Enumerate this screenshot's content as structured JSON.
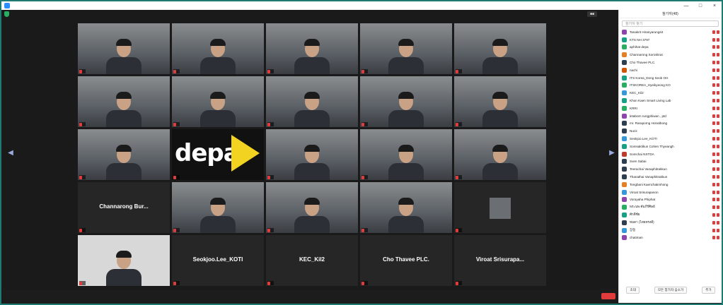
{
  "panel": {
    "title": "참가자(48)",
    "search_placeholder": "참가자 찾기",
    "participants": [
      {
        "name": "Tanakrit Hiranyarungsit",
        "color": "#8e44ad"
      },
      {
        "name": "KTS NH 3797",
        "color": "#16a085"
      },
      {
        "name": "aphihat depa",
        "color": "#27ae60"
      },
      {
        "name": "Channarong Sorrahirat",
        "color": "#e67e22"
      },
      {
        "name": "Cho Thavee PLC.",
        "color": "#2c3e50"
      },
      {
        "name": "nachi",
        "color": "#d35400"
      },
      {
        "name": "ITS Korea_Dong Seob OH",
        "color": "#16a085"
      },
      {
        "name": "ITSKOREA_Hyeikyeong KO",
        "color": "#27ae60"
      },
      {
        "name": "KEC_Kil2",
        "color": "#3498db"
      },
      {
        "name": "Khon Kaen Smart Living Lab",
        "color": "#16a085"
      },
      {
        "name": "KRRI",
        "color": "#27ae60"
      },
      {
        "name": "letaborn rungphiwan , ptd",
        "color": "#8e44ad"
      },
      {
        "name": "mr. Raraporng Horatibong",
        "color": "#2c3e50"
      },
      {
        "name": "Nut.k",
        "color": "#2c3e50"
      },
      {
        "name": "Seokjoo.Lee_KOTI",
        "color": "#3498db"
      },
      {
        "name": "Somsaktikun Cohen Thyeangh",
        "color": "#16a085"
      },
      {
        "name": "Somchai  NSTDA",
        "color": "#c0392b"
      },
      {
        "name": "Sven Sabai",
        "color": "#2c3e50"
      },
      {
        "name": "Teerachai Vanaphitrakkun",
        "color": "#2c3e50"
      },
      {
        "name": "Thanathai Vanaphitrakkun",
        "color": "#2c3e50"
      },
      {
        "name": "Tongbani Kaenchakmhong",
        "color": "#e67e22"
      },
      {
        "name": "Viroat Srisurapanon",
        "color": "#3498db"
      },
      {
        "name": "Vorayaha Phiphat",
        "color": "#8e44ad"
      },
      {
        "name": "พระนพ คัมภีร์ศิษย์",
        "color": "#27ae60"
      },
      {
        "name": "ศักดิ์ชัย",
        "color": "#16a085"
      },
      {
        "name": "ทมดา (ไทยทรงดี)",
        "color": "#2c3e50"
      },
      {
        "name": "장동",
        "color": "#3498db"
      },
      {
        "name": "chatiman",
        "color": "#8e44ad"
      }
    ],
    "btn_invite": "초대",
    "btn_mute_all": "모든 참가자 음소거",
    "btn_more": "추가"
  },
  "grid": {
    "tiles": [
      {
        "kind": "video",
        "name": ""
      },
      {
        "kind": "video",
        "name": ""
      },
      {
        "kind": "video",
        "name": ""
      },
      {
        "kind": "video",
        "name": ""
      },
      {
        "kind": "video",
        "name": ""
      },
      {
        "kind": "video",
        "name": ""
      },
      {
        "kind": "video",
        "name": ""
      },
      {
        "kind": "video",
        "name": ""
      },
      {
        "kind": "video",
        "name": ""
      },
      {
        "kind": "video",
        "name": ""
      },
      {
        "kind": "video",
        "name": ""
      },
      {
        "kind": "brand",
        "name": "",
        "text": "depa"
      },
      {
        "kind": "video",
        "name": ""
      },
      {
        "kind": "video",
        "name": ""
      },
      {
        "kind": "video",
        "name": ""
      },
      {
        "kind": "name",
        "name": "",
        "big": "Channarong  Bur..."
      },
      {
        "kind": "video",
        "name": ""
      },
      {
        "kind": "video",
        "name": ""
      },
      {
        "kind": "video",
        "name": ""
      },
      {
        "kind": "smallpic",
        "name": ""
      },
      {
        "kind": "portrait",
        "name": ""
      },
      {
        "kind": "name",
        "name": "",
        "big": "Seokjoo.Lee_KOTI"
      },
      {
        "kind": "name",
        "name": "",
        "big": "KEC_Kil2"
      },
      {
        "kind": "name",
        "name": "",
        "big": "Cho Thavee PLC."
      },
      {
        "kind": "name",
        "name": "",
        "big": "Viroat  Srisurapa..."
      }
    ]
  },
  "toolbar": {
    "buttons": []
  }
}
